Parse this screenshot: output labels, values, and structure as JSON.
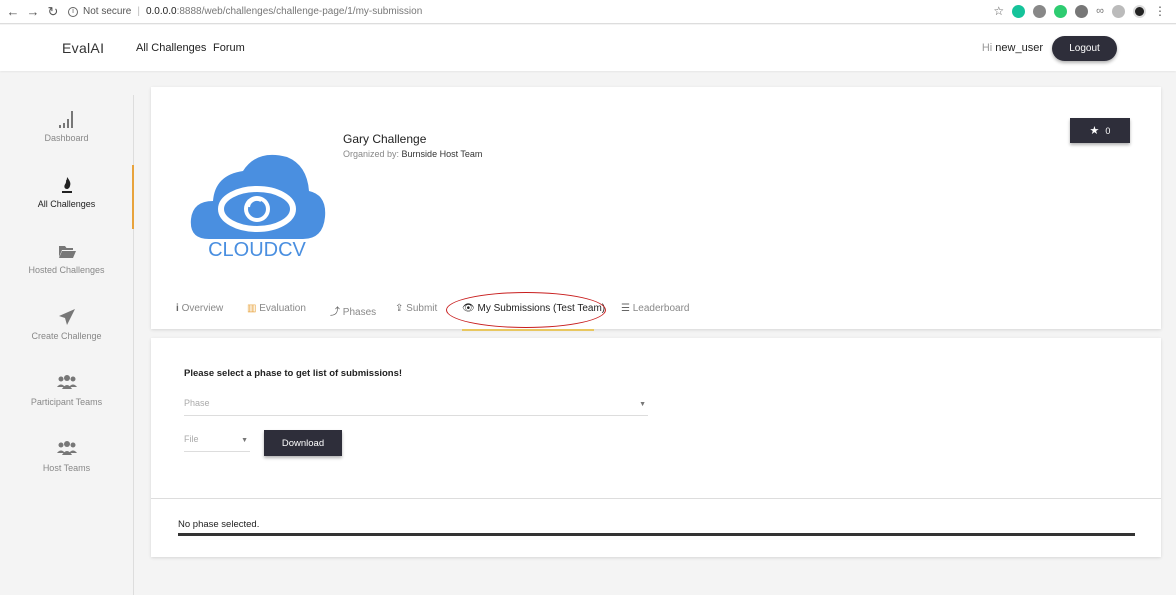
{
  "browser": {
    "not_secure": "Not secure",
    "url_host": "0.0.0.0",
    "url_path": ":8888/web/challenges/challenge-page/1/my-submission"
  },
  "navbar": {
    "brand": "EvalAI",
    "links": [
      "All Challenges",
      "Forum"
    ],
    "greeting_hi": "Hi",
    "username": "new_user",
    "logout_label": "Logout"
  },
  "sidebar": {
    "items": [
      {
        "label": "Dashboard",
        "icon": "bar-chart-icon"
      },
      {
        "label": "All Challenges",
        "icon": "flame-icon"
      },
      {
        "label": "Hosted Challenges",
        "icon": "folder-open-icon"
      },
      {
        "label": "Create Challenge",
        "icon": "paper-plane-icon"
      },
      {
        "label": "Participant Teams",
        "icon": "users-icon"
      },
      {
        "label": "Host Teams",
        "icon": "users-icon"
      }
    ]
  },
  "challenge": {
    "logo_text": "CLOUDCV",
    "title": "Gary Challenge",
    "organized_by_label": "Organized by:",
    "organizer": "Burnside Host Team",
    "star_count": "0"
  },
  "tabs": [
    {
      "label": "Overview",
      "icon": "info-icon"
    },
    {
      "label": "Evaluation",
      "icon": "bar-chart-icon"
    },
    {
      "label": "Phases",
      "icon": "arrow-up-icon"
    },
    {
      "label": "Submit",
      "icon": "upload-icon"
    },
    {
      "label": "My Submissions (Test Team)",
      "icon": "eye-icon"
    },
    {
      "label": "Leaderboard",
      "icon": "list-icon"
    }
  ],
  "submissions": {
    "prompt": "Please select a phase to get list of submissions!",
    "phase_placeholder": "Phase",
    "file_placeholder": "File",
    "download_label": "Download",
    "empty_message": "No phase selected."
  },
  "colors": {
    "dark_button": "#2e2e3a",
    "accent": "#e8a33c",
    "annotation_red": "#c81e1e",
    "logo_blue": "#4a8fe0"
  }
}
